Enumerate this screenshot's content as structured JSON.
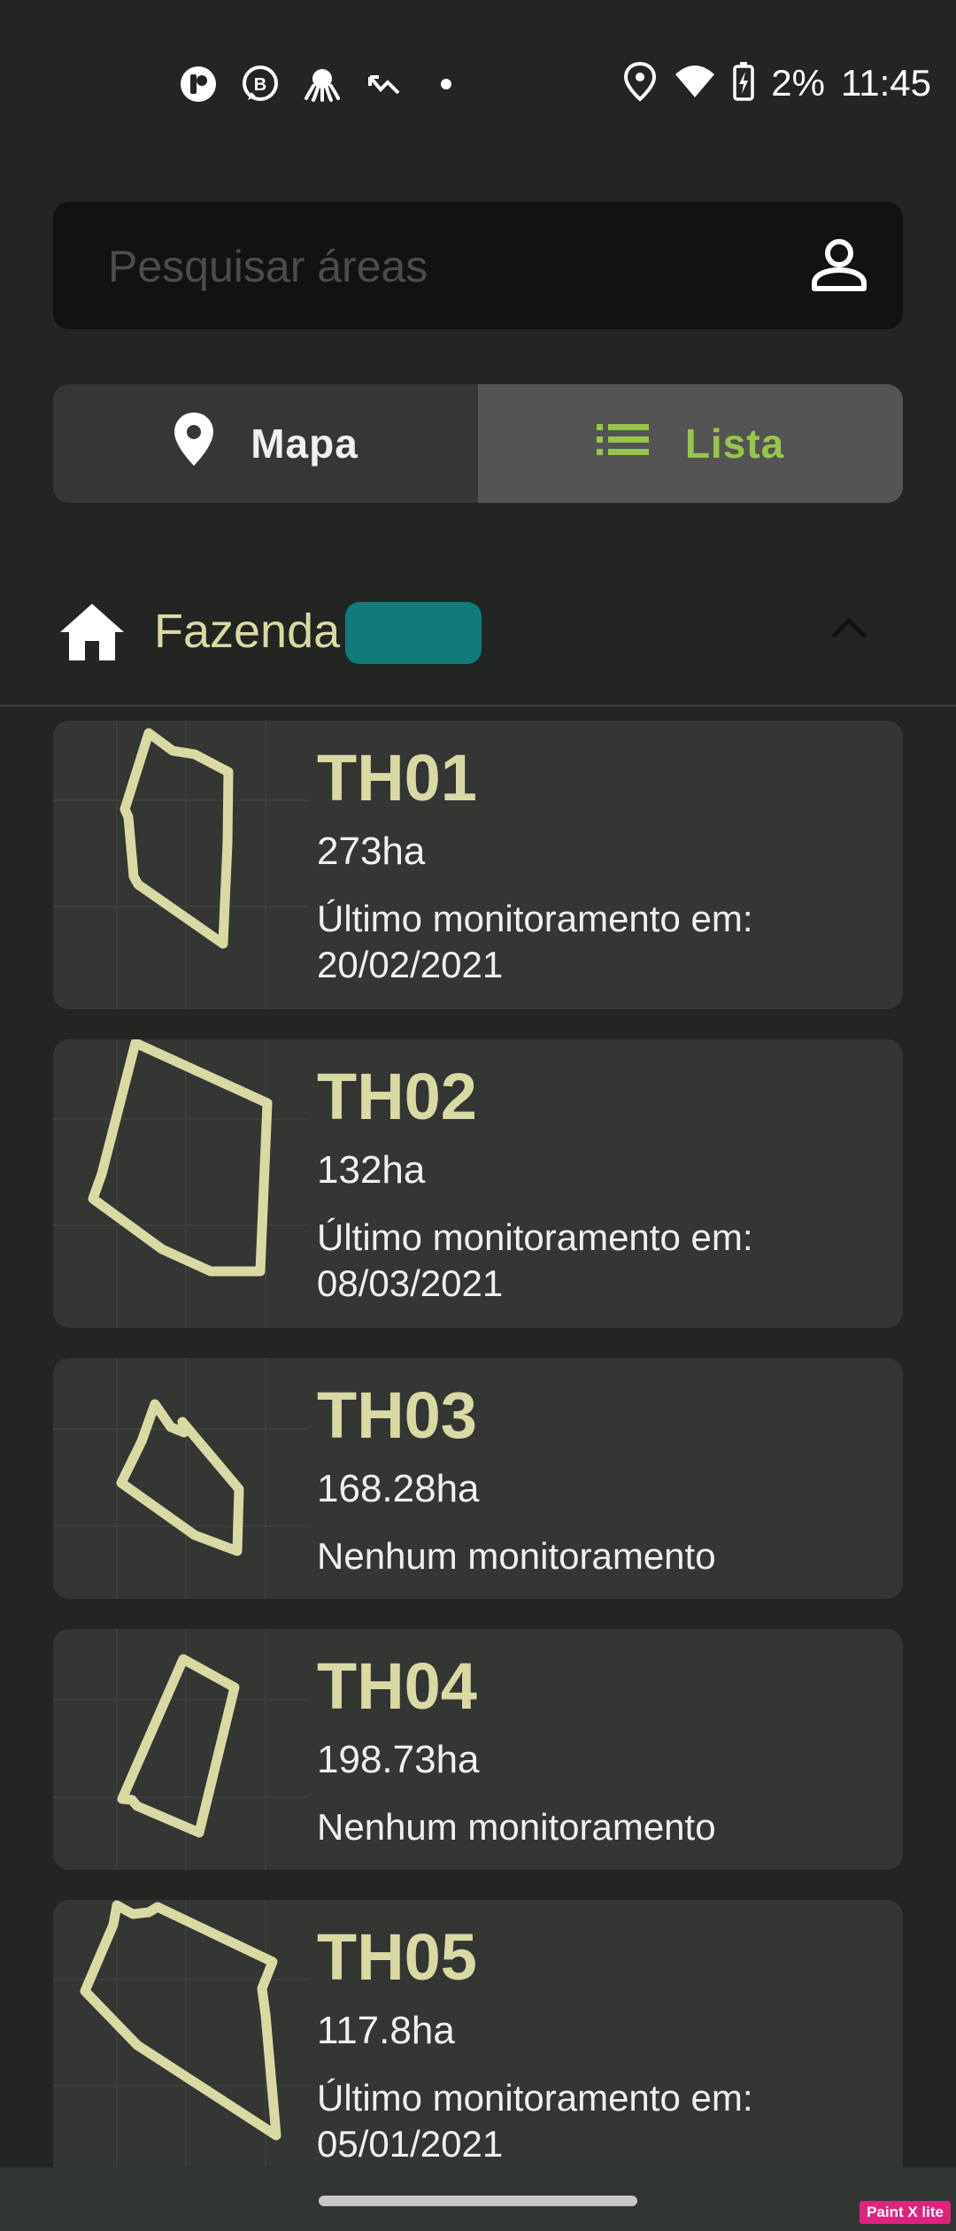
{
  "status_bar": {
    "time": "11:45",
    "battery": "2%",
    "left_icons": [
      "notification-app-icon",
      "whatsapp-business-icon",
      "octopus-icon",
      "missed-call-icon",
      "more-dot-icon"
    ],
    "right_icons": [
      "location-icon",
      "wifi-icon",
      "battery-charging-icon"
    ]
  },
  "search": {
    "placeholder": "Pesquisar áreas"
  },
  "view_toggle": {
    "map_label": "Mapa",
    "list_label": "Lista",
    "active": "list",
    "active_color": "#97c64a"
  },
  "farm": {
    "label": "Fazenda",
    "badge_color": "#107b7a"
  },
  "areas": [
    {
      "name": "TH01",
      "size": "273ha",
      "status": "Último monitoramento em: 20/02/2021"
    },
    {
      "name": "TH02",
      "size": "132ha",
      "status": "Último monitoramento em: 08/03/2021"
    },
    {
      "name": "TH03",
      "size": "168.28ha",
      "status": "Nenhum monitoramento"
    },
    {
      "name": "TH04",
      "size": "198.73ha",
      "status": "Nenhum monitoramento"
    },
    {
      "name": "TH05",
      "size": "117.8ha",
      "status": "Último monitoramento em: 05/01/2021"
    }
  ],
  "watermark": "Paint X lite",
  "colors": {
    "background": "#232523",
    "card": "#333633",
    "accent_text": "#d9d9a3",
    "polygon": "#d9d9a3"
  }
}
